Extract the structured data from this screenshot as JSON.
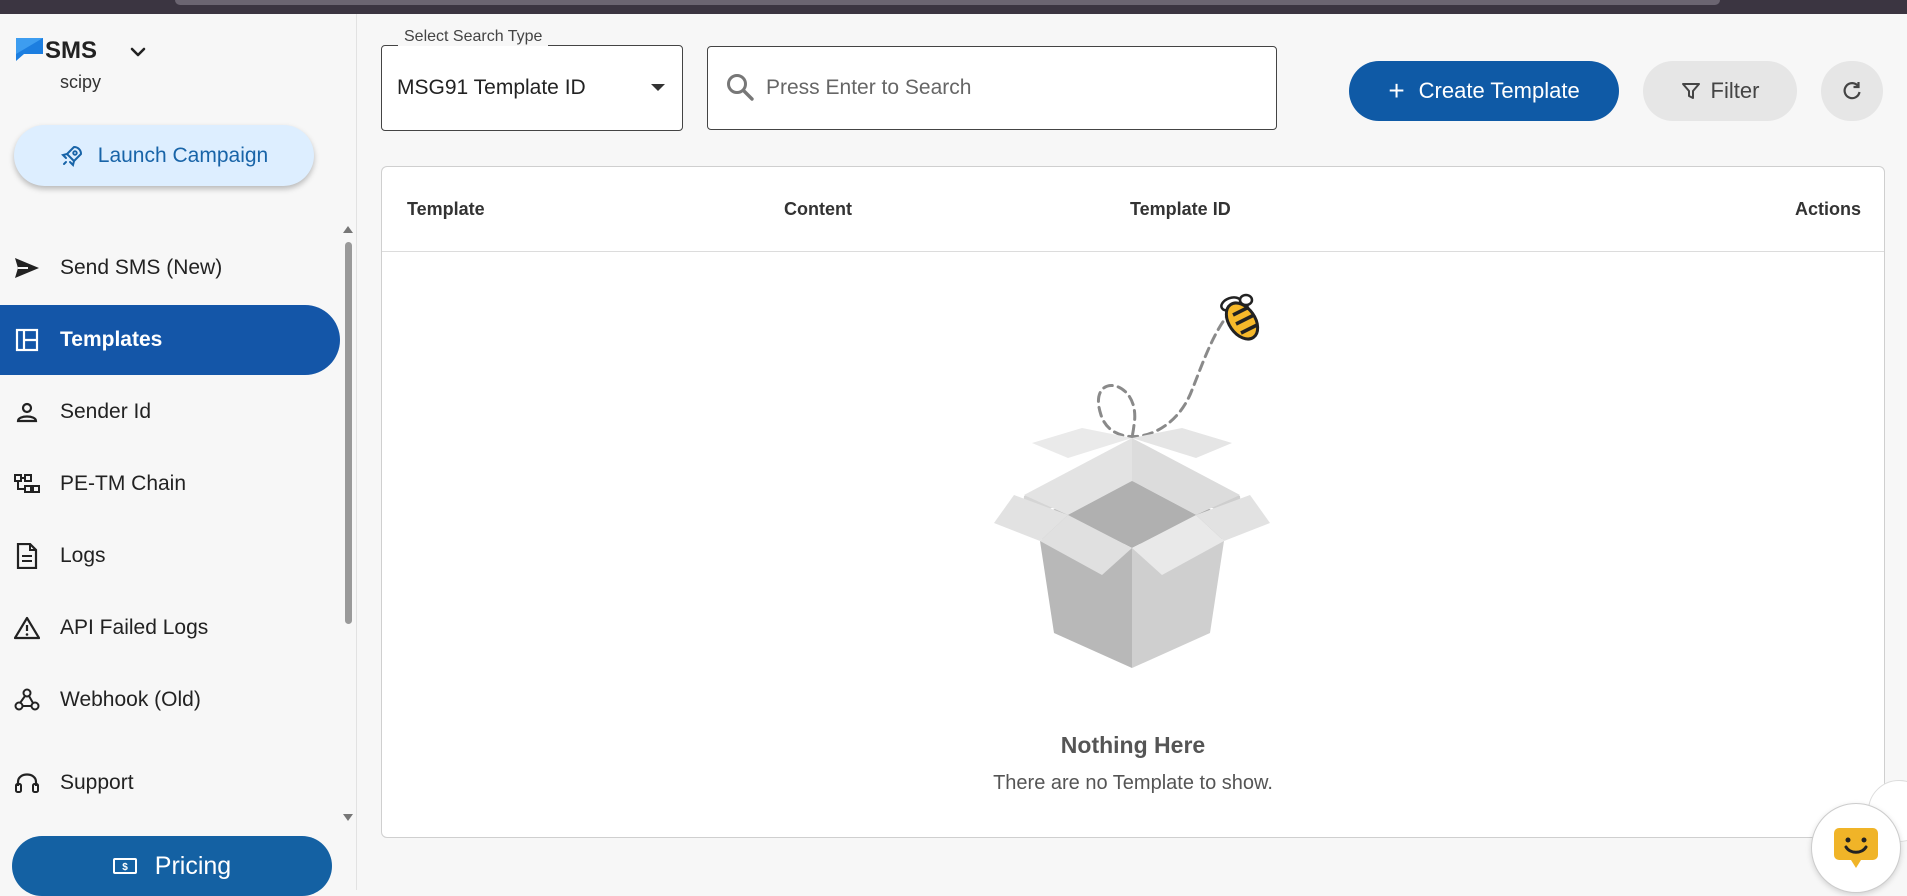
{
  "brand": {
    "title": "SMS",
    "subtitle": "scipy"
  },
  "sidebar": {
    "launch_label": "Launch Campaign",
    "items": [
      {
        "label": "Send SMS (New)",
        "icon": "send-icon",
        "active": false
      },
      {
        "label": "Templates",
        "icon": "templates-icon",
        "active": true
      },
      {
        "label": "Sender Id",
        "icon": "person-icon",
        "active": false
      },
      {
        "label": "PE-TM Chain",
        "icon": "chain-icon",
        "active": false
      },
      {
        "label": "Logs",
        "icon": "document-icon",
        "active": false
      },
      {
        "label": "API Failed Logs",
        "icon": "warning-icon",
        "active": false
      },
      {
        "label": "Webhook (Old)",
        "icon": "webhook-icon",
        "active": false
      },
      {
        "label": "Support",
        "icon": "headset-icon",
        "active": false
      }
    ],
    "pricing_label": "Pricing"
  },
  "toolbar": {
    "select_legend": "Select Search Type",
    "select_value": "MSG91 Template ID",
    "search_placeholder": "Press Enter to Search",
    "create_label": "Create Template",
    "filter_label": "Filter"
  },
  "table": {
    "columns": [
      "Template",
      "Content",
      "Template ID",
      "Actions"
    ],
    "empty_title": "Nothing Here",
    "empty_subtitle": "There are no Template to show."
  },
  "colors": {
    "primary": "#0f5aa6",
    "active_nav": "#1456a8",
    "launch_bg": "#ddeeff",
    "chat_icon": "#f0b428"
  }
}
